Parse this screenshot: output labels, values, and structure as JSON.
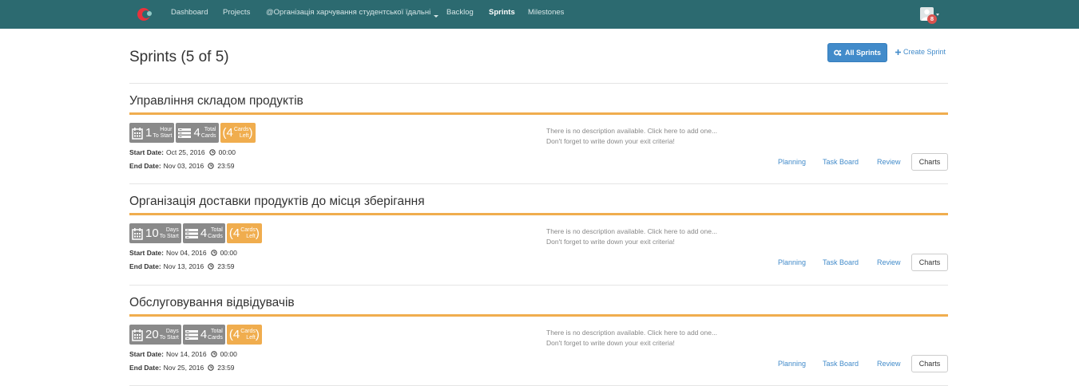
{
  "nav": {
    "items": [
      "Dashboard",
      "Projects",
      "@Організація харчування студентської їдальні",
      "Backlog",
      "Sprints",
      "Milestones"
    ],
    "notification_count": "8",
    "colors": {
      "bar": "#2c6a70",
      "logo_red": "#e8323c"
    }
  },
  "header": {
    "title": "Sprints (5 of 5)",
    "all_sprints_label": "All Sprints",
    "create_sprint_label": "Create Sprint"
  },
  "sprints": [
    {
      "name": "Управління складом продуктів",
      "time_value": "1",
      "time_unit_line1": "Hour",
      "time_unit_line2": "To Start",
      "total_value": "4",
      "total_line1": "Total",
      "total_line2": "Cards",
      "left_value": "4",
      "left_line1": "Cards",
      "left_line2": "Left",
      "start_label": "Start Date:",
      "start_date": "Oct 25, 2016",
      "start_time": "00:00",
      "end_label": "End Date:",
      "end_date": "Nov 03, 2016",
      "end_time": "23:59",
      "desc_line1": "There is no description available. Click here to add one...",
      "desc_line2": "Don't forget to write down your exit criteria!",
      "actions": [
        "Planning",
        "Task Board",
        "Review",
        "Charts"
      ]
    },
    {
      "name": "Організація доставки продуктів до місця зберігання",
      "time_value": "10",
      "time_unit_line1": "Days",
      "time_unit_line2": "To Start",
      "total_value": "4",
      "total_line1": "Total",
      "total_line2": "Cards",
      "left_value": "4",
      "left_line1": "Cards",
      "left_line2": "Left",
      "start_label": "Start Date:",
      "start_date": "Nov 04, 2016",
      "start_time": "00:00",
      "end_label": "End Date:",
      "end_date": "Nov 13, 2016",
      "end_time": "23:59",
      "desc_line1": "There is no description available. Click here to add one...",
      "desc_line2": "Don't forget to write down your exit criteria!",
      "actions": [
        "Planning",
        "Task Board",
        "Review",
        "Charts"
      ]
    },
    {
      "name": "Обслуговування відвідувачів",
      "time_value": "20",
      "time_unit_line1": "Days",
      "time_unit_line2": "To Start",
      "total_value": "4",
      "total_line1": "Total",
      "total_line2": "Cards",
      "left_value": "4",
      "left_line1": "Cards",
      "left_line2": "Left",
      "start_label": "Start Date:",
      "start_date": "Nov 14, 2016",
      "start_time": "00:00",
      "end_label": "End Date:",
      "end_date": "Nov 25, 2016",
      "end_time": "23:59",
      "desc_line1": "There is no description available. Click here to add one...",
      "desc_line2": "Don't forget to write down your exit criteria!",
      "actions": [
        "Planning",
        "Task Board",
        "Review",
        "Charts"
      ]
    }
  ]
}
